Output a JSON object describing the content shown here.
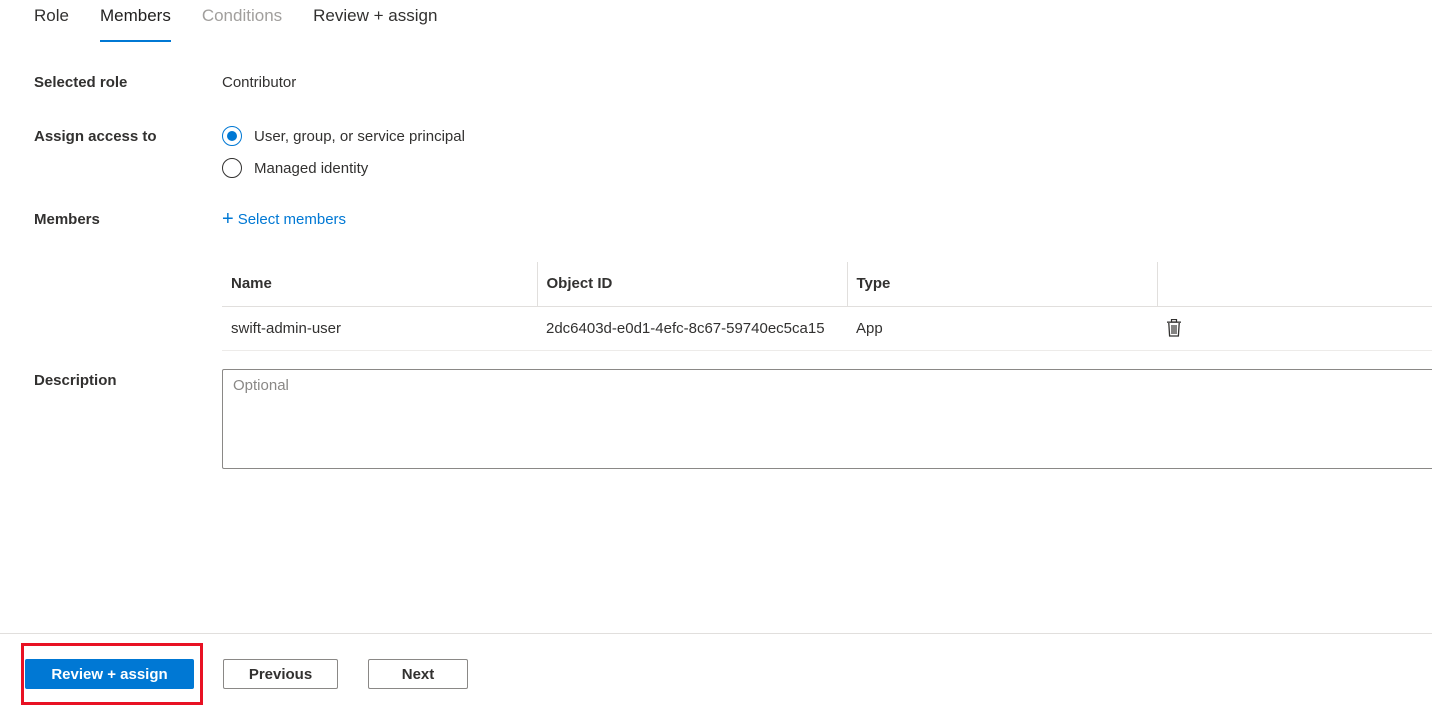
{
  "tabs": [
    {
      "label": "Role",
      "state": "normal"
    },
    {
      "label": "Members",
      "state": "active"
    },
    {
      "label": "Conditions",
      "state": "disabled"
    },
    {
      "label": "Review + assign",
      "state": "normal"
    }
  ],
  "selected_role": {
    "label": "Selected role",
    "value": "Contributor"
  },
  "assign_access": {
    "label": "Assign access to",
    "options": [
      {
        "label": "User, group, or service principal",
        "checked": true
      },
      {
        "label": "Managed identity",
        "checked": false
      }
    ]
  },
  "members": {
    "label": "Members",
    "select_link": "Select members",
    "table": {
      "columns": [
        "Name",
        "Object ID",
        "Type"
      ],
      "rows": [
        {
          "name": "swift-admin-user",
          "object_id": "2dc6403d-e0d1-4efc-8c67-59740ec5ca15",
          "type": "App"
        }
      ]
    }
  },
  "description": {
    "label": "Description",
    "placeholder": "Optional",
    "value": ""
  },
  "footer": {
    "review_assign": "Review + assign",
    "previous": "Previous",
    "next": "Next"
  },
  "colors": {
    "accent": "#0078d4",
    "highlight": "#e81123"
  },
  "icons": {
    "plus": "plus-icon",
    "delete": "trash-icon"
  }
}
